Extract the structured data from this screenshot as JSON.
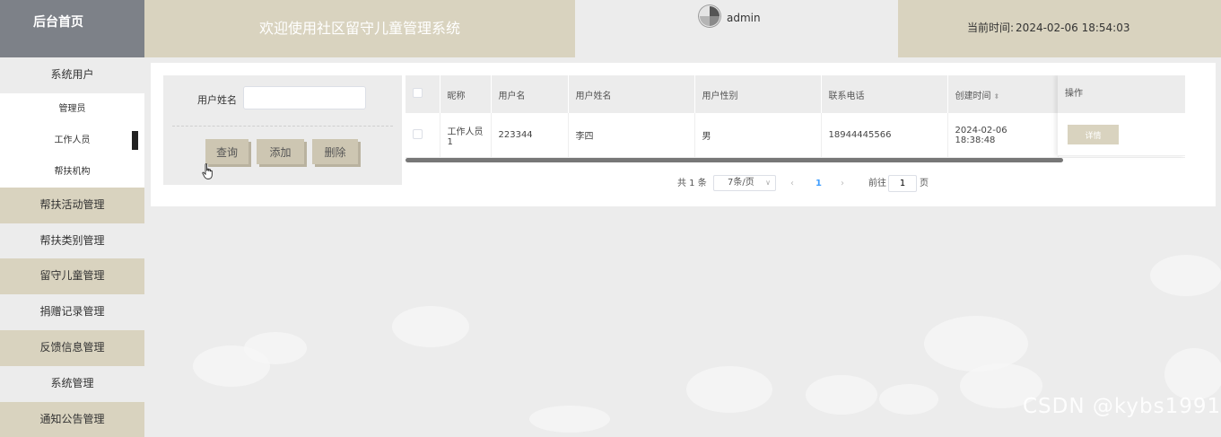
{
  "header": {
    "brand": "后台首页",
    "system_title": "欢迎使用社区留守儿童管理系统",
    "username": "admin",
    "time_label": "当前时间:",
    "time_value": "2024-02-06 18:54:03"
  },
  "sidebar": {
    "items": [
      {
        "label": "系统用户",
        "style": "light",
        "children": [
          "管理员",
          "工作人员",
          "帮扶机构"
        ]
      },
      {
        "label": "帮扶活动管理",
        "style": "tan"
      },
      {
        "label": "帮扶类别管理",
        "style": "light"
      },
      {
        "label": "留守儿童管理",
        "style": "tan"
      },
      {
        "label": "捐赠记录管理",
        "style": "light"
      },
      {
        "label": "反馈信息管理",
        "style": "tan"
      },
      {
        "label": "系统管理",
        "style": "light"
      },
      {
        "label": "通知公告管理",
        "style": "tan"
      }
    ],
    "active_child": "工作人员"
  },
  "search": {
    "label": "用户姓名",
    "input_value": "",
    "input_placeholder": "",
    "query_label": "查询",
    "add_label": "添加",
    "delete_label": "删除"
  },
  "table": {
    "columns": [
      "昵称",
      "用户名",
      "用户姓名",
      "用户性别",
      "联系电话",
      "创建时间",
      "操作"
    ],
    "rows": [
      {
        "nickname": "工作人员1",
        "username": "223344",
        "realname": "李四",
        "gender": "男",
        "phone": "18944445566",
        "created": "2024-02-06 18:38:48"
      }
    ],
    "detail_label": "详情"
  },
  "pagination": {
    "total": "共 1 条",
    "page_size": "7条/页",
    "current_page": "1",
    "goto_label": "前往",
    "goto_value": "1",
    "page_unit": "页"
  },
  "watermark": "CSDN @kybs1991",
  "colors": {
    "tan": "#d9d3bf",
    "brand_bg": "#7d8188",
    "page_bg": "#ececec",
    "accent": "#409eff"
  }
}
